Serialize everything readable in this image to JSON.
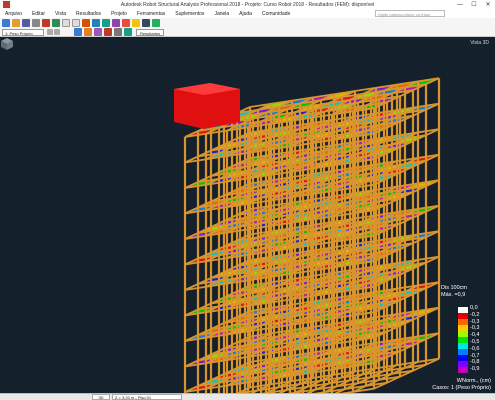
{
  "app": {
    "title": "Autodesk Robot Structural Analysis Professional 2018 - Projeto: Curso Robot 2018 - Resultados (FEM): disponível",
    "window_buttons": [
      "—",
      "☐",
      "✕"
    ]
  },
  "menu": {
    "items": [
      "Arquivo",
      "Editar",
      "Vista",
      "Resultados",
      "Projeto",
      "Ferramentas",
      "Suplementos",
      "Janela",
      "Ajuda",
      "Comunidade"
    ],
    "search_placeholder": "Digite palavra-chave ou frase"
  },
  "toolbar": {
    "case_select": "1: Peso Próprio",
    "results_select": "Resultados"
  },
  "viewport": {
    "view_label": "Vista 3D",
    "background": "#14202c"
  },
  "legend": {
    "title_line1": "Dis  100cm",
    "title_line2": "Máx. =0,9",
    "values": [
      "0,0",
      "-0,2",
      "-0,3",
      "-0,3",
      "-0,4",
      "-0,5",
      "-0,6",
      "-0,7",
      "-0,8",
      "-0,9"
    ],
    "colors": [
      "#ffffff",
      "#e60000",
      "#ff6600",
      "#ffcc00",
      "#99ff00",
      "#00e600",
      "#00e6e6",
      "#0080ff",
      "#0000ff",
      "#8000ff",
      "#c000c0"
    ],
    "caption_line1": "WNorm., (cm)",
    "caption_line2": "Casos: 1 (Peso Próprio)"
  },
  "status": {
    "view": "3D",
    "level": "Z = 3,20 m - Piso 01"
  }
}
